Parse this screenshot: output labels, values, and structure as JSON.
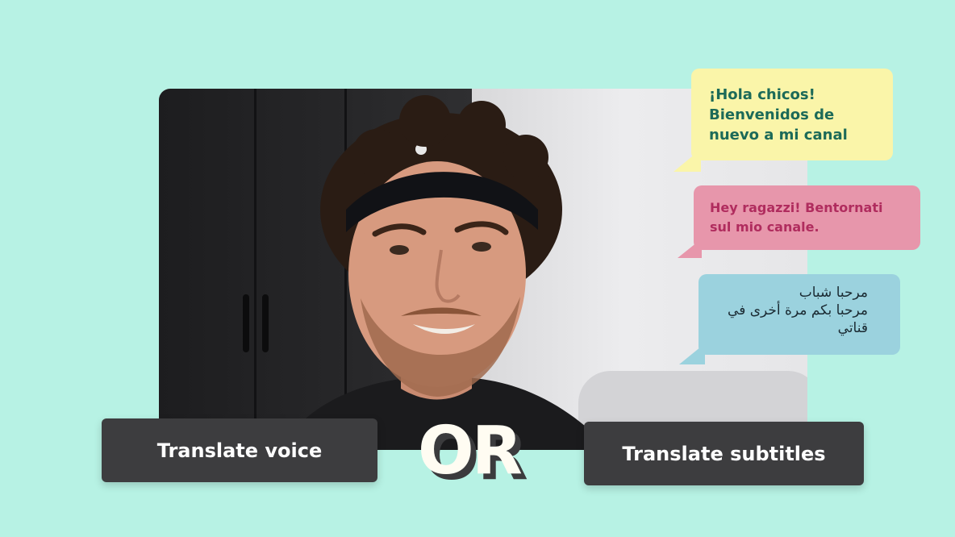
{
  "bubbles": {
    "spanish": {
      "line1": "¡Hola chicos!",
      "line2": "Bienvenidos de",
      "line3": "nuevo a mi canal",
      "color": "#faf5a9",
      "text_color": "#1c6a58"
    },
    "italian": {
      "line1": "Hey ragazzi! Bentornati",
      "line2": "sul mio canale.",
      "color": "#e796ab",
      "text_color": "#b02c5e"
    },
    "arabic": {
      "line1": "مرحبا شباب",
      "line2": "مرحبا بكم مرة أخرى في",
      "line3": "قناتي",
      "color": "#9bd2de",
      "text_color": "#1a2a32"
    }
  },
  "actions": {
    "voice_label": "Translate voice",
    "or_label": "OR",
    "subtitles_label": "Translate subtitles"
  },
  "colors": {
    "background": "#b7f2e4",
    "button": "#3d3d3f",
    "or_fill": "#fffcf2"
  }
}
